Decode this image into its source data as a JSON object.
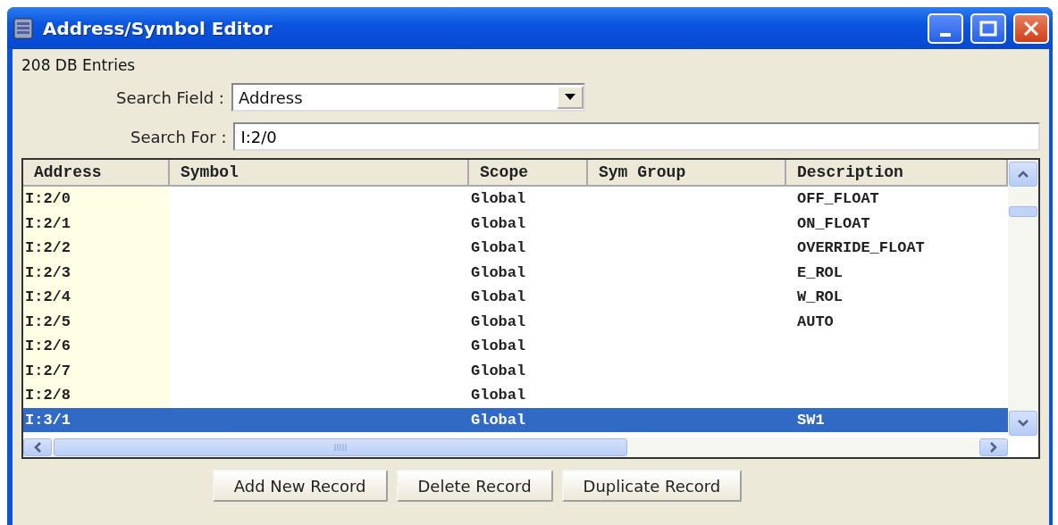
{
  "window": {
    "title": "Address/Symbol Editor"
  },
  "entry_count": "208  DB Entries",
  "search_field": {
    "label": "Search Field :",
    "value": "Address"
  },
  "search_for": {
    "label": "Search For :",
    "value": "I:2/0"
  },
  "table": {
    "columns": [
      "Address",
      "Symbol",
      "Scope",
      "Sym Group",
      "Description"
    ],
    "rows": [
      {
        "cells": [
          "I:2/0",
          "",
          "Global",
          "",
          "OFF_FLOAT"
        ],
        "selected": false
      },
      {
        "cells": [
          "I:2/1",
          "",
          "Global",
          "",
          "ON_FLOAT"
        ],
        "selected": false
      },
      {
        "cells": [
          "I:2/2",
          "",
          "Global",
          "",
          "OVERRIDE_FLOAT"
        ],
        "selected": false
      },
      {
        "cells": [
          "I:2/3",
          "",
          "Global",
          "",
          "E_ROL"
        ],
        "selected": false
      },
      {
        "cells": [
          "I:2/4",
          "",
          "Global",
          "",
          "W_ROL"
        ],
        "selected": false
      },
      {
        "cells": [
          "I:2/5",
          "",
          "Global",
          "",
          "AUTO"
        ],
        "selected": false
      },
      {
        "cells": [
          "I:2/6",
          "",
          "Global",
          "",
          ""
        ],
        "selected": false
      },
      {
        "cells": [
          "I:2/7",
          "",
          "Global",
          "",
          ""
        ],
        "selected": false
      },
      {
        "cells": [
          "I:2/8",
          "",
          "Global",
          "",
          ""
        ],
        "selected": false
      },
      {
        "cells": [
          "I:3/1",
          "",
          "Global",
          "",
          "SW1"
        ],
        "selected": true
      }
    ]
  },
  "buttons": [
    "Add New Record",
    "Delete Record",
    "Duplicate Record"
  ]
}
